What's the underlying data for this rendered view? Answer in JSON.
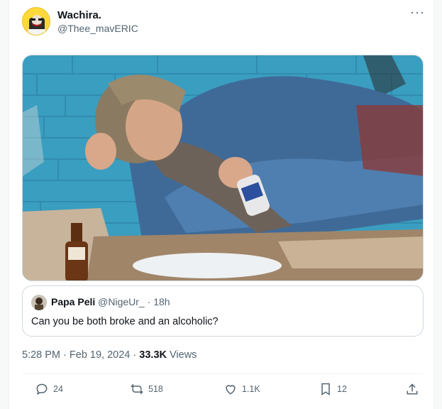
{
  "tweet": {
    "author": {
      "display_name": "Wachira.",
      "handle": "@Thee_mavERIC"
    },
    "more_label": "···",
    "quoted": {
      "display_name": "Papa Peli",
      "handle": "@NigeUr_",
      "separator": "·",
      "age": "18h",
      "text": "Can you be both broke and an alcoholic?"
    },
    "time": "5:28 PM",
    "dot": "·",
    "date": "Feb 19, 2024",
    "views_count": "33.3K",
    "views_label": "Views",
    "actions": {
      "replies": "24",
      "reposts": "518",
      "likes": "1.1K",
      "bookmarks": "12"
    }
  },
  "colors": {
    "secondary_text": "#536471",
    "border": "#cfd9de",
    "wall_blue": "#3a9ec0",
    "avatar_yellow": "#ffd93b"
  },
  "icons": [
    "reply-icon",
    "repost-icon",
    "like-icon",
    "bookmark-icon",
    "share-icon",
    "more-icon"
  ]
}
